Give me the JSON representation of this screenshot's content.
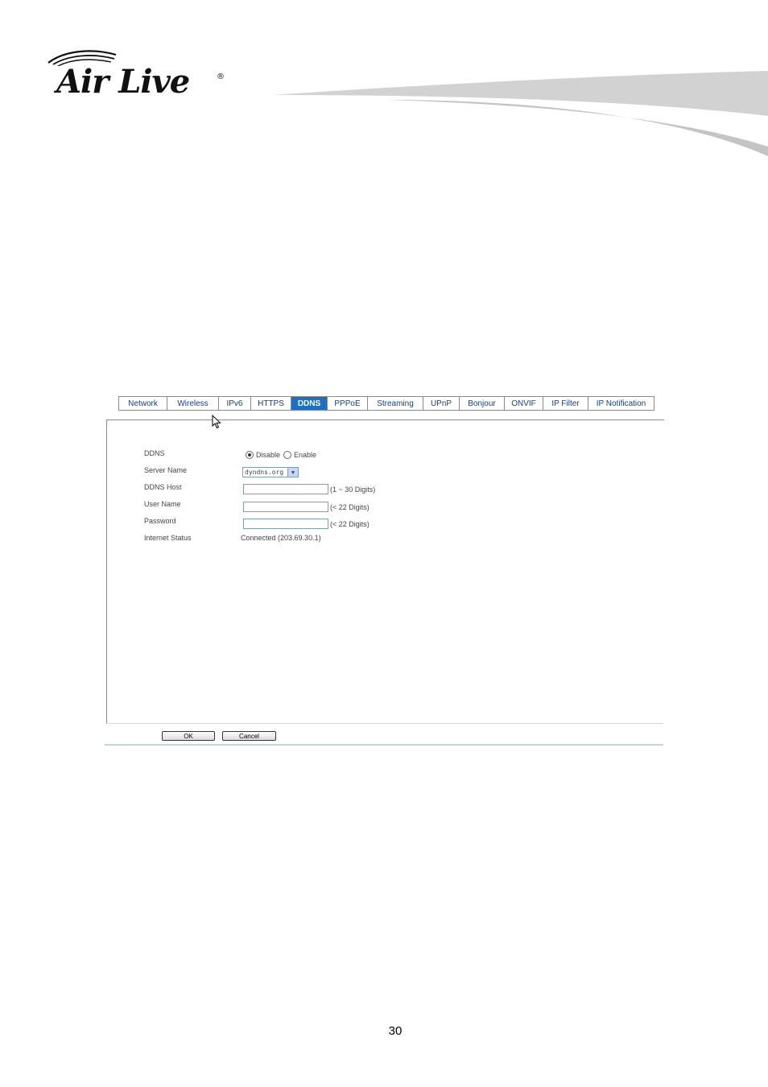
{
  "brand": {
    "name": "Air Live",
    "registered": "®"
  },
  "tabs": [
    {
      "label": "Network"
    },
    {
      "label": "Wireless"
    },
    {
      "label": "IPv6"
    },
    {
      "label": "HTTPS"
    },
    {
      "label": "DDNS",
      "active": true
    },
    {
      "label": "PPPoE"
    },
    {
      "label": "Streaming"
    },
    {
      "label": "UPnP"
    },
    {
      "label": "Bonjour"
    },
    {
      "label": "ONVIF"
    },
    {
      "label": "IP Filter"
    },
    {
      "label": "IP Notification"
    }
  ],
  "form": {
    "ddns": {
      "label": "DDNS",
      "options": [
        "Disable",
        "Enable"
      ],
      "selected": "Disable"
    },
    "server_name": {
      "label": "Server Name",
      "value": "dyndns.org"
    },
    "ddns_host": {
      "label": "DDNS Host",
      "value": "",
      "hint": "(1 ~ 30 Digits)"
    },
    "user_name": {
      "label": "User Name",
      "value": "",
      "hint": "(< 22 Digits)"
    },
    "password": {
      "label": "Password",
      "value": "",
      "hint": "(< 22 Digits)"
    },
    "internet_status": {
      "label": "Internet Status",
      "value": "Connected (203.69.30.1)"
    }
  },
  "buttons": {
    "ok": "OK",
    "cancel": "Cancel"
  },
  "page_number": "30",
  "colors": {
    "active_tab": "#1e6fc4",
    "tab_text": "#0c3f9e"
  }
}
